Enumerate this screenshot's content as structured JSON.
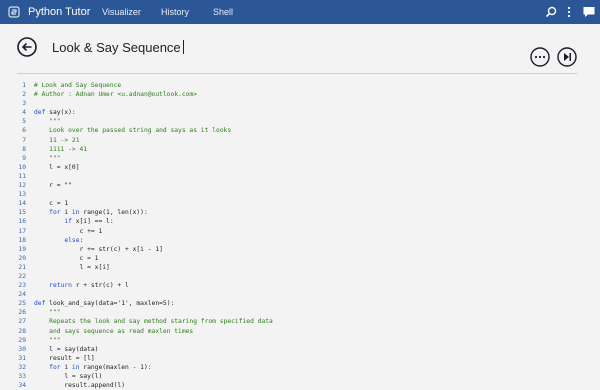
{
  "app": {
    "title": "Python Tutor",
    "nav": [
      "Visualizer",
      "History",
      "Shell"
    ],
    "icons": [
      "python-logo-icon",
      "search-icon",
      "more-icon",
      "chat-icon"
    ]
  },
  "colors": {
    "topbar": "#2b5797",
    "comment": "#2e7d1b",
    "keyword": "#1d49d8",
    "line_number": "#3a6aa8"
  },
  "page": {
    "title": "Look & Say Sequence"
  },
  "toolbar": {
    "more_icon": "more-circle-icon",
    "step_icon": "step-forward-icon",
    "back_icon": "back-arrow-icon"
  },
  "code": [
    {
      "n": "1",
      "t": "# Look and Say Sequence",
      "c": "cm"
    },
    {
      "n": "2",
      "t": "# Author : Adnan Umer <u.adnan@outlook.com>",
      "c": "cm"
    },
    {
      "n": "3",
      "t": "",
      "c": ""
    },
    {
      "n": "4",
      "t": "def say(x):",
      "c": ""
    },
    {
      "n": "5",
      "t": "    \"\"\"",
      "c": "cm"
    },
    {
      "n": "6",
      "t": "    Look over the passed string and says as it looks",
      "c": "cm"
    },
    {
      "n": "7",
      "t": "    11 -> 21",
      "c": "cm"
    },
    {
      "n": "8",
      "t": "    1111 -> 41",
      "c": "cm"
    },
    {
      "n": "9",
      "t": "    \"\"\"",
      "c": "cm"
    },
    {
      "n": "10",
      "t": "    l = x[0]",
      "c": ""
    },
    {
      "n": "11",
      "t": "",
      "c": ""
    },
    {
      "n": "12",
      "t": "    r = \"\"",
      "c": ""
    },
    {
      "n": "13",
      "t": "",
      "c": ""
    },
    {
      "n": "14",
      "t": "    c = 1",
      "c": ""
    },
    {
      "n": "15",
      "t": "    for i in range(1, len(x)):",
      "c": ""
    },
    {
      "n": "16",
      "t": "        if x[i] == l:",
      "c": ""
    },
    {
      "n": "17",
      "t": "            c += 1",
      "c": ""
    },
    {
      "n": "18",
      "t": "        else:",
      "c": ""
    },
    {
      "n": "19",
      "t": "            r += str(c) + x[i - 1]",
      "c": ""
    },
    {
      "n": "20",
      "t": "            c = 1",
      "c": ""
    },
    {
      "n": "21",
      "t": "            l = x[i]",
      "c": ""
    },
    {
      "n": "22",
      "t": "",
      "c": ""
    },
    {
      "n": "23",
      "t": "    return r + str(c) + l",
      "c": ""
    },
    {
      "n": "24",
      "t": "",
      "c": ""
    },
    {
      "n": "25",
      "t": "def look_and_say(data='1', maxlen=5):",
      "c": ""
    },
    {
      "n": "26",
      "t": "    \"\"\"",
      "c": "cm"
    },
    {
      "n": "27",
      "t": "    Repeats the look and say method staring from specified data",
      "c": "cm"
    },
    {
      "n": "28",
      "t": "    and says sequence as read maxlen times",
      "c": "cm"
    },
    {
      "n": "29",
      "t": "    \"\"\"",
      "c": "cm"
    },
    {
      "n": "30",
      "t": "    l = say(data)",
      "c": ""
    },
    {
      "n": "31",
      "t": "    result = [l]",
      "c": ""
    },
    {
      "n": "32",
      "t": "    for i in range(maxlen - 1):",
      "c": ""
    },
    {
      "n": "33",
      "t": "        l = say(l)",
      "c": ""
    },
    {
      "n": "34",
      "t": "        result.append(l)",
      "c": ""
    }
  ]
}
